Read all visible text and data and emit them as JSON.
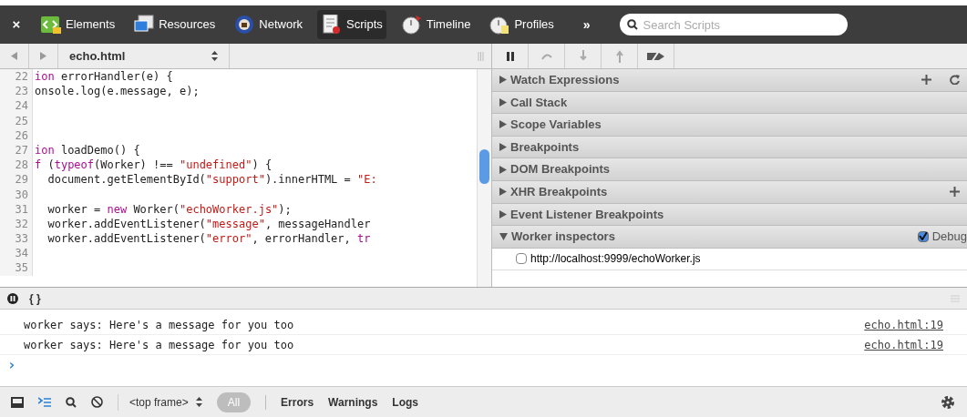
{
  "toolbar": {
    "close": "×",
    "tabs": [
      {
        "label": "Elements",
        "selected": false
      },
      {
        "label": "Resources",
        "selected": false
      },
      {
        "label": "Network",
        "selected": false
      },
      {
        "label": "Scripts",
        "selected": true
      },
      {
        "label": "Timeline",
        "selected": false
      },
      {
        "label": "Profiles",
        "selected": false
      }
    ],
    "overflow": "»",
    "search": {
      "placeholder": "Search Scripts"
    }
  },
  "editor": {
    "file": "echo.html",
    "lines": [
      {
        "number": "22",
        "tokens": [
          {
            "kind": "keyword",
            "text": "ion"
          },
          {
            "kind": "plain",
            "text": " errorHandler(e) {"
          }
        ]
      },
      {
        "number": "23",
        "tokens": [
          {
            "kind": "plain",
            "text": "onsole.log(e.message, e);"
          }
        ]
      },
      {
        "number": "24"
      },
      {
        "number": "25"
      },
      {
        "number": "26"
      },
      {
        "number": "27",
        "tokens": [
          {
            "kind": "keyword",
            "text": "ion"
          },
          {
            "kind": "plain",
            "text": " loadDemo() {"
          }
        ]
      },
      {
        "number": "28",
        "tokens": [
          {
            "kind": "keyword",
            "text": "f"
          },
          {
            "kind": "plain",
            "text": " ("
          },
          {
            "kind": "keyword",
            "text": "typeof"
          },
          {
            "kind": "plain",
            "text": "(Worker) !== "
          },
          {
            "kind": "string",
            "text": "\"undefined\""
          },
          {
            "kind": "plain",
            "text": ") {"
          }
        ]
      },
      {
        "number": "29",
        "tokens": [
          {
            "kind": "plain",
            "text": "  document.getElementById("
          },
          {
            "kind": "string",
            "text": "\"support\""
          },
          {
            "kind": "plain",
            "text": ").innerHTML = "
          },
          {
            "kind": "string",
            "text": "\"E:"
          }
        ]
      },
      {
        "number": "30"
      },
      {
        "number": "31",
        "tokens": [
          {
            "kind": "plain",
            "text": "  worker = "
          },
          {
            "kind": "keyword",
            "text": "new"
          },
          {
            "kind": "plain",
            "text": " Worker("
          },
          {
            "kind": "string",
            "text": "\"echoWorker.js\""
          },
          {
            "kind": "plain",
            "text": ");"
          }
        ]
      },
      {
        "number": "32",
        "tokens": [
          {
            "kind": "plain",
            "text": "  worker.addEventListener("
          },
          {
            "kind": "string",
            "text": "\"message\""
          },
          {
            "kind": "plain",
            "text": ", messageHandler"
          }
        ]
      },
      {
        "number": "33",
        "tokens": [
          {
            "kind": "plain",
            "text": "  worker.addEventListener("
          },
          {
            "kind": "string",
            "text": "\"error\""
          },
          {
            "kind": "plain",
            "text": ", errorHandler, "
          },
          {
            "kind": "keyword",
            "text": "tr"
          }
        ]
      },
      {
        "number": "34"
      },
      {
        "number": "35"
      }
    ]
  },
  "sidebar": {
    "sections": [
      {
        "title": "Watch Expressions",
        "expanded": false,
        "actions": [
          {
            "kind": "add"
          },
          {
            "kind": "refresh"
          }
        ]
      },
      {
        "title": "Call Stack",
        "expanded": false
      },
      {
        "title": "Scope Variables",
        "expanded": false
      },
      {
        "title": "Breakpoints",
        "expanded": false
      },
      {
        "title": "DOM Breakpoints",
        "expanded": false
      },
      {
        "title": "XHR Breakpoints",
        "expanded": false,
        "actions": [
          {
            "kind": "add"
          }
        ]
      },
      {
        "title": "Event Listener Breakpoints",
        "expanded": false
      },
      {
        "title": "Worker inspectors",
        "expanded": true,
        "option": {
          "label": "Debug",
          "checked": true
        },
        "items": [
          {
            "label": "http://localhost:9999/echoWorker.js",
            "checked": false
          }
        ]
      }
    ]
  },
  "console": {
    "format_button": "{ }",
    "messages": [
      {
        "text": "worker says: Here's a message for you too",
        "source": "echo.html:19"
      },
      {
        "text": "worker says: Here's a message for you too",
        "source": "echo.html:19"
      }
    ],
    "prompt": "›",
    "frame": "<top frame>",
    "filters": [
      {
        "label": "All",
        "selected": true
      },
      {
        "label": "Errors",
        "selected": false
      },
      {
        "label": "Warnings",
        "selected": false
      },
      {
        "label": "Logs",
        "selected": false
      }
    ]
  }
}
